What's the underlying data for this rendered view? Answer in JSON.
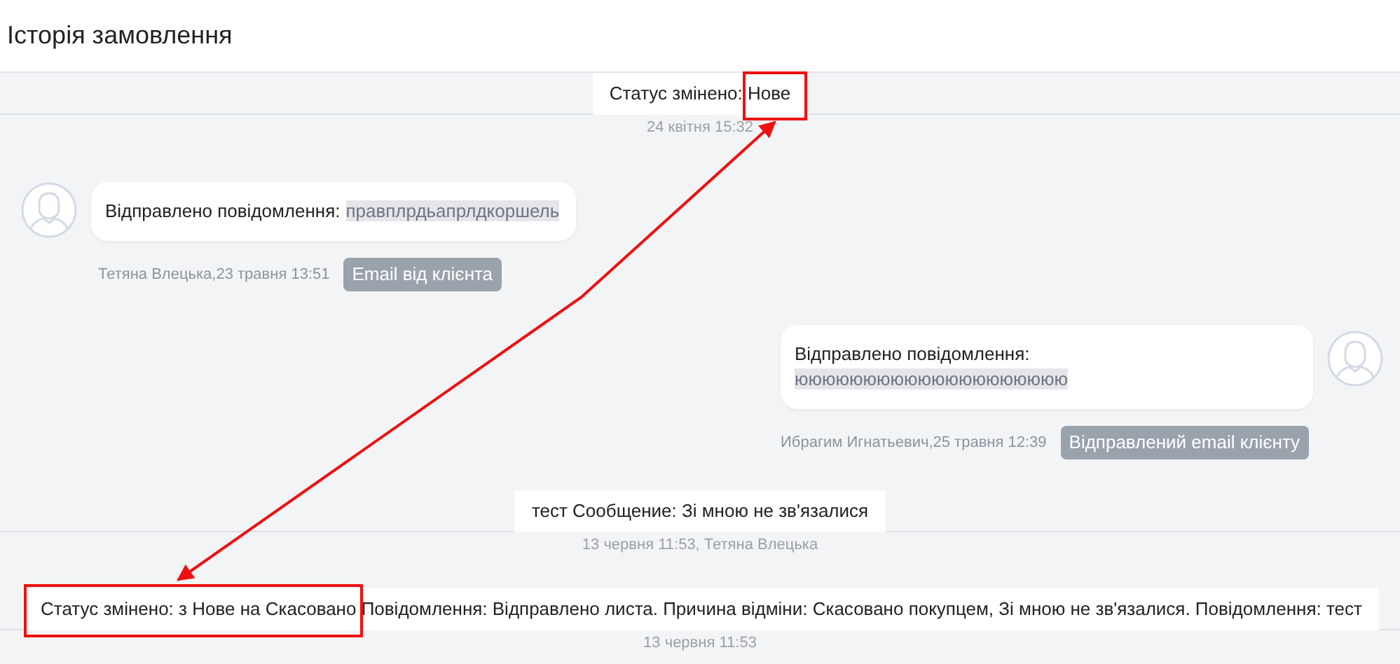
{
  "title": "Історія замовлення",
  "entries": [
    {
      "kind": "event",
      "text": "Статус змінено: Нове",
      "time": "24 квітня 15:32"
    },
    {
      "kind": "incoming",
      "label": "Відправлено повідомлення:",
      "hidden_text": "правплрдьапрлдкоршель",
      "author": "Тетяна Влецька,23 травня 13:51",
      "tag": "Email від клієнта"
    },
    {
      "kind": "outgoing",
      "label": "Відправлено повідомлення:",
      "hidden_text": "юююююююююююююююююююю",
      "author": "Ибрагим Игнатьевич,25 травня 12:39",
      "tag": "Відправлений email клієнту"
    },
    {
      "kind": "event",
      "text": "тест Сообщение: Зі мною не зв'язалися",
      "time": "13 червня 11:53, Тетяна Влецька"
    },
    {
      "kind": "event",
      "text": "Статус змінено: з Нове на Скасовано Повідомлення: Відправлено листа. Причина відміни: Скасовано покупцем, Зі мною не зв'язалися. Повідомлення: тест",
      "time": "13 червня 11:53"
    }
  ]
}
